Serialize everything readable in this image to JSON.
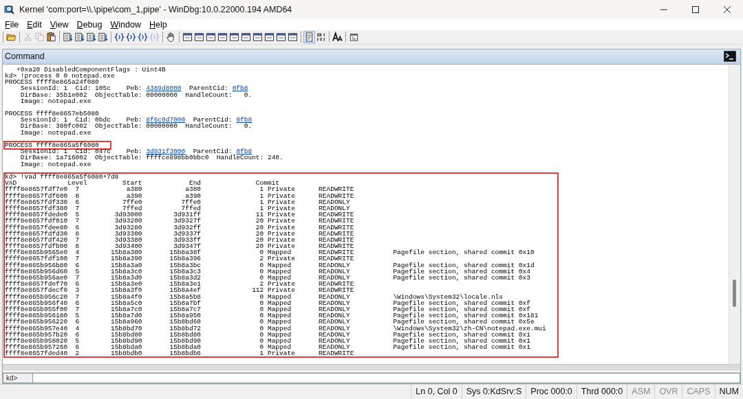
{
  "window": {
    "title": "Kernel 'com:port=\\\\.\\pipe\\com_1,pipe' - WinDbg:10.0.22000.194 AMD64"
  },
  "menu": [
    "File",
    "Edit",
    "View",
    "Debug",
    "Window",
    "Help"
  ],
  "toolbar": {
    "groups": [
      {
        "items": [
          {
            "kind": "open",
            "disabled": false,
            "selected": false
          }
        ]
      },
      {
        "items": [
          {
            "kind": "cut",
            "disabled": true,
            "selected": false
          },
          {
            "kind": "copy",
            "disabled": true,
            "selected": false
          },
          {
            "kind": "paste",
            "disabled": false,
            "selected": false
          }
        ]
      },
      {
        "items": [
          {
            "kind": "list",
            "disabled": false,
            "selected": false
          },
          {
            "kind": "list",
            "disabled": false,
            "selected": false
          },
          {
            "kind": "list",
            "disabled": false,
            "selected": false
          },
          {
            "kind": "list",
            "disabled": false,
            "selected": false
          }
        ]
      },
      {
        "items": [
          {
            "kind": "braces",
            "disabled": false,
            "selected": false
          },
          {
            "kind": "braces",
            "disabled": false,
            "selected": false
          },
          {
            "kind": "braces",
            "disabled": false,
            "selected": false
          },
          {
            "kind": "braces",
            "disabled": true,
            "selected": false
          }
        ]
      },
      {
        "items": [
          {
            "kind": "hand",
            "disabled": false,
            "selected": false
          }
        ]
      },
      {
        "items": [
          {
            "kind": "window",
            "disabled": false,
            "selected": false
          },
          {
            "kind": "window",
            "disabled": false,
            "selected": false
          },
          {
            "kind": "window",
            "disabled": false,
            "selected": false
          },
          {
            "kind": "window",
            "disabled": false,
            "selected": false
          },
          {
            "kind": "window",
            "disabled": false,
            "selected": false
          },
          {
            "kind": "window",
            "disabled": false,
            "selected": false
          },
          {
            "kind": "window",
            "disabled": false,
            "selected": false
          },
          {
            "kind": "window",
            "disabled": false,
            "selected": false
          },
          {
            "kind": "window",
            "disabled": false,
            "selected": false
          },
          {
            "kind": "window",
            "disabled": false,
            "selected": false
          }
        ]
      },
      {
        "items": [
          {
            "kind": "source",
            "disabled": false,
            "selected": true
          },
          {
            "kind": "binary",
            "disabled": false,
            "selected": false
          }
        ]
      },
      {
        "items": [
          {
            "kind": "font",
            "disabled": false,
            "selected": false
          }
        ]
      },
      {
        "items": [
          {
            "kind": "options",
            "disabled": false,
            "selected": false
          }
        ]
      }
    ]
  },
  "command": {
    "title": "Command",
    "blocks": [
      {
        "blank_line_before": false,
        "highlighted": false,
        "lines": [
          {
            "segments": [
              {
                "text": "   +0xa20 DisabledComponentFlags : Uint4B",
                "link": false
              }
            ]
          },
          {
            "segments": [
              {
                "text": "kd> !process 0 0 notepad.exe",
                "link": false
              }
            ]
          },
          {
            "segments": [
              {
                "text": "PROCESS ffff8e865a24f080",
                "link": false
              }
            ]
          },
          {
            "segments": [
              {
                "text": "    SessionId: 1  Cid: 105c    Peb: ",
                "link": false
              },
              {
                "text": "4389d8000",
                "link": true
              },
              {
                "text": "  ParentCid: ",
                "link": false
              },
              {
                "text": "0fb8",
                "link": true
              }
            ]
          },
          {
            "segments": [
              {
                "text": "    DirBase: 35b1e002  ObjectTable: 00000000  HandleCount:   0.",
                "link": false
              }
            ]
          },
          {
            "segments": [
              {
                "text": "    Image: notepad.exe",
                "link": false
              }
            ]
          }
        ]
      },
      {
        "blank_line_before": true,
        "highlighted": false,
        "lines": [
          {
            "segments": [
              {
                "text": "PROCESS ffff8e8657eb5080",
                "link": false
              }
            ]
          },
          {
            "segments": [
              {
                "text": "    SessionId: 1  Cid: 0bdc    Peb: ",
                "link": false
              },
              {
                "text": "8f6c0d7000",
                "link": true
              },
              {
                "text": "  ParentCid: ",
                "link": false
              },
              {
                "text": "0fb8",
                "link": true
              }
            ]
          },
          {
            "segments": [
              {
                "text": "    DirBase: 380fc002  ObjectTable: 00000000  HandleCount:   0.",
                "link": false
              }
            ]
          },
          {
            "segments": [
              {
                "text": "    Image: notepad.exe",
                "link": false
              }
            ]
          }
        ]
      },
      {
        "blank_line_before": true,
        "highlighted": true,
        "lines": [
          {
            "segments": [
              {
                "text": "PROCESS ffff8e865a5f6080",
                "link": false
              }
            ]
          }
        ]
      },
      {
        "blank_line_before": false,
        "highlighted": false,
        "lines": [
          {
            "segments": [
              {
                "text": "    SessionId: 1  Cid: 047c    Peb: ",
                "link": false
              },
              {
                "text": "3d931f3000",
                "link": true
              },
              {
                "text": "  ParentCid: ",
                "link": false
              },
              {
                "text": "0fb8",
                "link": true
              }
            ]
          },
          {
            "segments": [
              {
                "text": "    DirBase: 1a716002  ObjectTable: ffffce898bb0bbc0  HandleCount: 240.",
                "link": false
              }
            ]
          },
          {
            "segments": [
              {
                "text": "    Image: notepad.exe",
                "link": false
              }
            ]
          }
        ]
      },
      {
        "blank_line_before": true,
        "highlighted": true,
        "lines": [
          {
            "segments": [
              {
                "text": "kd> !vad ffff8e865a5f6080+7d8",
                "link": false
              }
            ]
          },
          {
            "segments": [
              {
                "text": "VAD             Level         Start            End              Commit",
                "link": false
              }
            ]
          },
          {
            "segments": [
              {
                "text": "ffff8e8657fdf7e0  7            a380           a380               1 Private      READWRITE",
                "link": false
              }
            ]
          },
          {
            "segments": [
              {
                "text": "ffff8e8657fdf600  8            a390           a390               1 Private      READWRITE",
                "link": false
              }
            ]
          },
          {
            "segments": [
              {
                "text": "ffff8e8657fdf330  6           7ffe0          7ffe0               1 Private      READONLY",
                "link": false
              }
            ]
          },
          {
            "segments": [
              {
                "text": "ffff8e8657fdf380  7           7ffed          7ffed               1 Private      READONLY",
                "link": false
              }
            ]
          },
          {
            "segments": [
              {
                "text": "ffff8e8657fdede0  5         3d93000        3d931ff              11 Private      READWRITE",
                "link": false
              }
            ]
          },
          {
            "segments": [
              {
                "text": "ffff8e8657fdf010  7         3d93200        3d9327f              20 Private      READWRITE",
                "link": false
              }
            ]
          },
          {
            "segments": [
              {
                "text": "ffff8e8657fdee80  6         3d93280        3d932ff              20 Private      READWRITE",
                "link": false
              }
            ]
          },
          {
            "segments": [
              {
                "text": "ffff8e8657fdfd30  8         3d93300        3d9337f              20 Private      READWRITE",
                "link": false
              }
            ]
          },
          {
            "segments": [
              {
                "text": "ffff8e8657fdf420  7         3d93380        3d933ff              20 Private      READWRITE",
                "link": false
              }
            ]
          },
          {
            "segments": [
              {
                "text": "ffff8e8657fdfb00  8         3d93400        3d9347f              20 Private      READWRITE",
                "link": false
              }
            ]
          },
          {
            "segments": [
              {
                "text": "ffff8e865b9565e0  4        15b8a380       15b8a38f               0 Mapped       READWRITE          Pagefile section, shared commit 0x10",
                "link": false
              }
            ]
          },
          {
            "segments": [
              {
                "text": "ffff8e8657fdf100  7        15b8a390       15b8a396               2 Private      READWRITE",
                "link": false
              }
            ]
          },
          {
            "segments": [
              {
                "text": "ffff8e865b956b80  6        15b8a3a0       15b8a3bc               0 Mapped       READONLY           Pagefile section, shared commit 0x1d",
                "link": false
              }
            ]
          },
          {
            "segments": [
              {
                "text": "ffff8e865b956d60  5        15b8a3c0       15b8a3c3               0 Mapped       READONLY           Pagefile section, shared commit 0x4",
                "link": false
              }
            ]
          },
          {
            "segments": [
              {
                "text": "ffff8e865b956ae0  7        15b8a3d0       15b8a3d2               0 Mapped       READONLY           Pagefile section, shared commit 0x3",
                "link": false
              }
            ]
          },
          {
            "segments": [
              {
                "text": "ffff8e8657fdef70  6        15b8a3e0       15b8a3e1               2 Private      READWRITE",
                "link": false
              }
            ]
          },
          {
            "segments": [
              {
                "text": "ffff8e8657fdecf0  3        15b8a3f0       15b8a4ef             112 Private      READWRITE",
                "link": false
              }
            ]
          },
          {
            "segments": [
              {
                "text": "ffff8e865b956c20  7        15b8a4f0       15b8a5b8               0 Mapped       READONLY           \\Windows\\System32\\locale.nls",
                "link": false
              }
            ]
          },
          {
            "segments": [
              {
                "text": "ffff8e865b956f40  6        15b8a5c0       15b8a7bf               0 Mapped       READONLY           Pagefile section, shared commit 0xf",
                "link": false
              }
            ]
          },
          {
            "segments": [
              {
                "text": "ffff8e865b955f00  7        15b8a7c0       15b8a7c7               0 Mapped       READONLY           Pagefile section, shared commit 0xf",
                "link": false
              }
            ]
          },
          {
            "segments": [
              {
                "text": "ffff8e865b956180  5        15b8a7d0       15b8a950               0 Mapped       READONLY           Pagefile section, shared commit 0x181",
                "link": false
              }
            ]
          },
          {
            "segments": [
              {
                "text": "ffff8e865b956220  6        15b8a960       15b8bd60               0 Mapped       READONLY           Pagefile section, shared commit 0x5e",
                "link": false
              }
            ]
          },
          {
            "segments": [
              {
                "text": "ffff8e865b957e40  4        15b8bd70       15b8bd72               0 Mapped       READONLY           \\Windows\\System32\\zh-CN\\notepad.exe.mui",
                "link": false
              }
            ]
          },
          {
            "segments": [
              {
                "text": "ffff8e865b957b20  6        15b8bd80       15b8bd80               0 Mapped       READONLY           Pagefile section, shared commit 0x1",
                "link": false
              }
            ]
          },
          {
            "segments": [
              {
                "text": "ffff8e865b958020  5        15b8bd90       15b8bd90               0 Mapped       READONLY           Pagefile section, shared commit 0x1",
                "link": false
              }
            ]
          },
          {
            "segments": [
              {
                "text": "ffff8e865b957260  6        15b8bda0       15b8bda0               0 Mapped       READONLY           Pagefile section, shared commit 0x1",
                "link": false
              }
            ]
          },
          {
            "segments": [
              {
                "text": "ffff8e8657fded40  2        15b8bdb0       15b8bdb6               1 Private      READWRITE",
                "link": false
              }
            ]
          }
        ]
      }
    ],
    "prompt": "kd>"
  },
  "status_bar": [
    {
      "text": "Ln 0, Col 0",
      "active": true
    },
    {
      "text": "Sys 0:KdSrv:S",
      "active": true
    },
    {
      "text": "Proc 000:0",
      "active": true
    },
    {
      "text": "Thrd 000:0",
      "active": true
    },
    {
      "text": "ASM",
      "active": false
    },
    {
      "text": "OVR",
      "active": false
    },
    {
      "text": "CAPS",
      "active": false
    },
    {
      "text": "NUM",
      "active": true
    }
  ]
}
